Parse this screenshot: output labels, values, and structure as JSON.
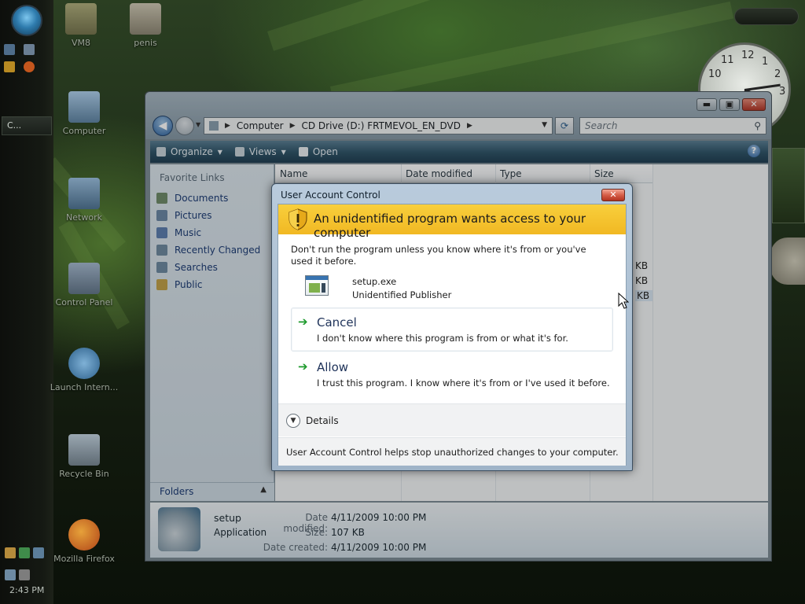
{
  "desktop": {
    "icons": [
      {
        "label": "VM8"
      },
      {
        "label": "penis"
      },
      {
        "label": "Computer"
      },
      {
        "label": "Network"
      },
      {
        "label": "Control Panel"
      },
      {
        "label": "Launch Intern..."
      },
      {
        "label": "Recycle Bin"
      },
      {
        "label": "Mozilla Firefox"
      }
    ],
    "clock_numbers": [
      "12",
      "1",
      "2",
      "3",
      "10",
      "11"
    ],
    "taskbar": {
      "task_label": "C...",
      "time": "2:43 PM"
    }
  },
  "explorer": {
    "address": {
      "segments": [
        "Computer",
        "CD Drive (D:) FRTMEVOL_EN_DVD"
      ]
    },
    "search_placeholder": "Search",
    "toolbar": {
      "organize": "Organize",
      "views": "Views",
      "open": "Open"
    },
    "help": "?",
    "favorite_links_title": "Favorite Links",
    "favorite_links": [
      "Documents",
      "Pictures",
      "Music",
      "Recently Changed",
      "Searches",
      "Public"
    ],
    "folders_label": "Folders",
    "columns": {
      "name": "Name",
      "date": "Date modified",
      "type": "Type",
      "size": "Size"
    },
    "size_fragments": [
      "KB",
      "KB",
      "KB"
    ],
    "details": {
      "name": "setup",
      "type": "Application",
      "date_modified_label": "Date modified:",
      "date_modified": "4/11/2009 10:00 PM",
      "size_label": "Size:",
      "size": "107 KB",
      "date_created_label": "Date created:",
      "date_created": "4/11/2009 10:00 PM"
    }
  },
  "uac": {
    "title": "User Account Control",
    "heading": "An unidentified program wants access to your computer",
    "warning": "Don't run the program unless you know where it's from or you've used it before.",
    "program_name": "setup.exe",
    "publisher": "Unidentified Publisher",
    "cancel": {
      "title": "Cancel",
      "desc": "I don't know where this program is from or what it's for."
    },
    "allow": {
      "title": "Allow",
      "desc": "I trust this program. I know where it's from or I've used it before."
    },
    "details_label": "Details",
    "footer": "User Account Control helps stop unauthorized changes to your computer."
  },
  "colors": {
    "banner": "#f1b823",
    "option_title": "#1e3259",
    "arrow_green": "#1d9a2c",
    "link_blue": "#1e3d76"
  }
}
